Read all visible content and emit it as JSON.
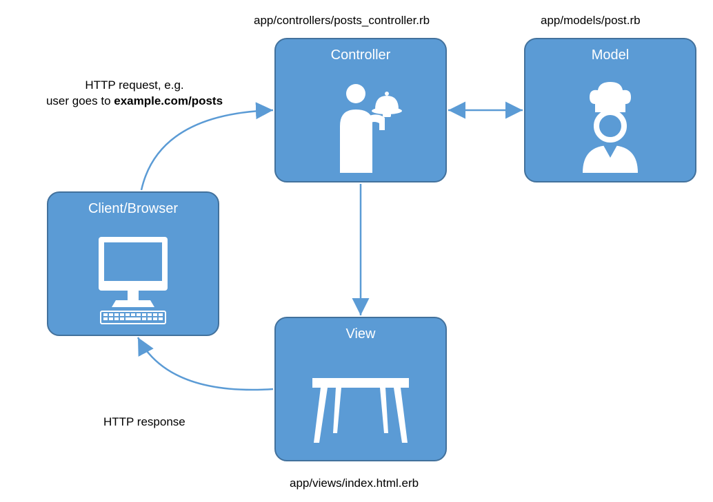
{
  "boxes": {
    "controller": {
      "title": "Controller",
      "path": "app/controllers/posts_controller.rb"
    },
    "model": {
      "title": "Model",
      "path": "app/models/post.rb"
    },
    "client": {
      "title": "Client/Browser"
    },
    "view": {
      "title": "View",
      "path": "app/views/index.html.erb"
    }
  },
  "annotations": {
    "request_line1": "HTTP request, e.g.",
    "request_line2_a": "user goes to ",
    "request_line2_b": "example.com/posts",
    "response": "HTTP response"
  },
  "colors": {
    "box_fill": "#5B9BD5",
    "box_border": "#42719C",
    "arrow": "#5B9BD5"
  }
}
